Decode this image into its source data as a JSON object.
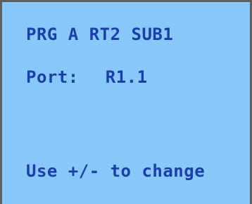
{
  "screen": {
    "line1": "PRG A RT2 SUB1",
    "port_label": "Port:",
    "port_value": "R1.1",
    "hint": "Use +/- to change"
  }
}
